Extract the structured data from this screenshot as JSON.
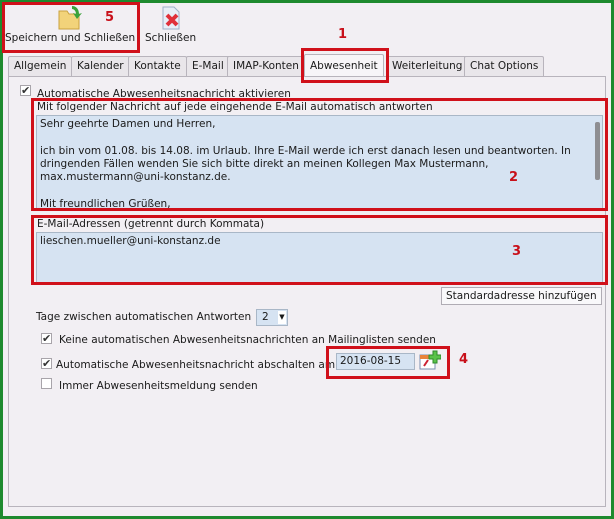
{
  "toolbar": {
    "save_close_label": "Speichern und Schließen",
    "close_label": "Schließen"
  },
  "tabs": [
    "Allgemein",
    "Kalender",
    "Kontakte",
    "E-Mail",
    "IMAP-Konten",
    "Abwesenheit",
    "Weiterleitung",
    "Chat Options"
  ],
  "active_tab": "Abwesenheit",
  "form": {
    "enable_label": "Automatische Abwesenheitsnachricht aktivieren",
    "enable_checked": true,
    "message_label": "Mit folgender Nachricht auf jede eingehende E-Mail automatisch antworten",
    "message_value": "Sehr geehrte Damen und Herren,\n\nich bin vom 01.08. bis 14.08. im Urlaub. Ihre E-Mail werde ich erst danach lesen und beantworten. In dringenden Fällen wenden Sie sich bitte direkt an meinen Kollegen Max Mustermann, max.mustermann@uni-konstanz.de.\n\nMit freundlichen Grüßen,\nLieschen Müller",
    "addresses_label": "E-Mail-Adressen (getrennt durch Kommata)",
    "addresses_value": "lieschen.mueller@uni-konstanz.de",
    "add_default_button": "Standardadresse hinzufügen",
    "days_label": "Tage zwischen automatischen Antworten",
    "days_value": "2",
    "no_mailinglists_label": "Keine automatischen Abwesenheitsnachrichten an Mailinglisten senden",
    "no_mailinglists_checked": true,
    "disable_on_label": "Automatische Abwesenheitsnachricht abschalten am",
    "disable_on_checked": true,
    "disable_date": "2016-08-15",
    "always_send_label": "Immer Abwesenheitsmeldung senden",
    "always_send_checked": false
  },
  "annotations": [
    "1",
    "2",
    "3",
    "4",
    "5"
  ],
  "colors": {
    "annotation_red": "#d0101a",
    "frame_green": "#1e8a2e",
    "field_blue": "#d6e3f2"
  }
}
